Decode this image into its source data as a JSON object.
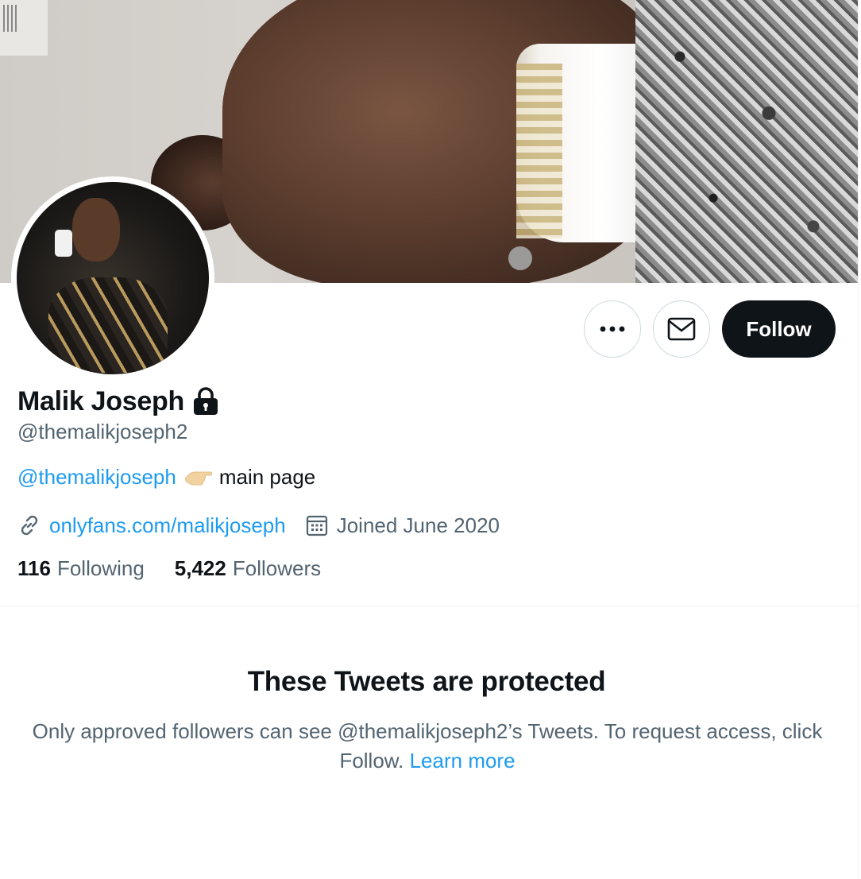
{
  "profile": {
    "name": "Malik Joseph",
    "handle": "@themalikjoseph2",
    "bio": {
      "mention": "@themalikjoseph",
      "emoji": "👈",
      "text": "main page"
    },
    "website": "onlyfans.com/malikjoseph",
    "joined": "Joined June 2020",
    "following_count": "116",
    "following_label": "Following",
    "followers_count": "5,422",
    "followers_label": "Followers",
    "protected": true
  },
  "actions": {
    "follow_label": "Follow",
    "more_icon": "more-horizontal-icon",
    "message_icon": "envelope-icon"
  },
  "protected_notice": {
    "title": "These Tweets are protected",
    "body": "Only approved followers can see @themalikjoseph2’s Tweets. To request access, click Follow.",
    "learn_more": "Learn more"
  },
  "colors": {
    "accent": "#1d9bf0",
    "text_primary": "#0f1419",
    "text_secondary": "#536471",
    "button_dark": "#0f1419",
    "border": "#cfd9de"
  }
}
